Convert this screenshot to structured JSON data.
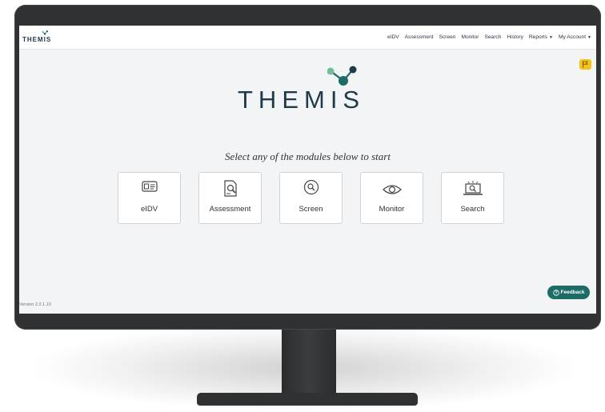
{
  "app": {
    "brand": "THEMIS",
    "logo_text": "THEMIS"
  },
  "nav": {
    "items": [
      "eIDV",
      "Assessment",
      "Screen",
      "Monitor",
      "Search",
      "History"
    ],
    "reports": "Reports",
    "account": "My Account"
  },
  "main": {
    "prompt": "Select any of the modules below to start",
    "modules": [
      {
        "label": "eIDV",
        "icon": "id-card-icon"
      },
      {
        "label": "Assessment",
        "icon": "document-search-icon"
      },
      {
        "label": "Screen",
        "icon": "magnifier-icon"
      },
      {
        "label": "Monitor",
        "icon": "eye-icon"
      },
      {
        "label": "Search",
        "icon": "laptop-search-icon"
      }
    ]
  },
  "footer": {
    "version": "Version 2.2.1.10"
  },
  "feedback": {
    "label": "Feedback",
    "icon": "help-circle-icon"
  },
  "colors": {
    "brand_teal": "#1d6b66",
    "brand_navy": "#1f3a4a",
    "flag_yellow": "#f6c31a",
    "logo_green": "#6fbf9b"
  }
}
